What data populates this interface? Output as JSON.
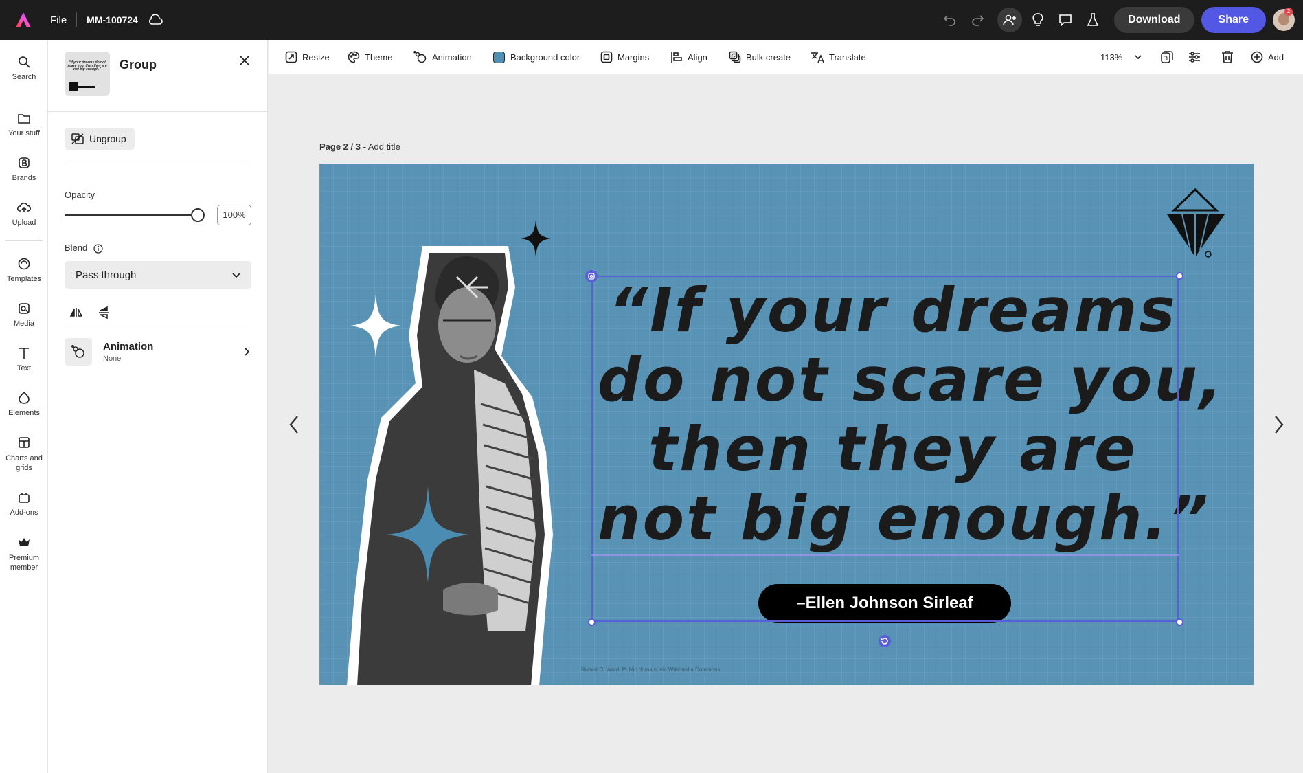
{
  "topbar": {
    "file_label": "File",
    "doc_name": "MM-100724",
    "download_label": "Download",
    "share_label": "Share",
    "notification_count": "2"
  },
  "rail": [
    {
      "label": "Search",
      "icon": "search-icon"
    },
    {
      "label": "Your stuff",
      "icon": "folder-icon"
    },
    {
      "label": "Brands",
      "icon": "brand-icon"
    },
    {
      "label": "Upload",
      "icon": "upload-icon"
    },
    {
      "label": "Templates",
      "icon": "templates-icon"
    },
    {
      "label": "Media",
      "icon": "media-icon"
    },
    {
      "label": "Text",
      "icon": "text-icon"
    },
    {
      "label": "Elements",
      "icon": "elements-icon"
    },
    {
      "label": "Charts and grids",
      "icon": "grid-icon"
    },
    {
      "label": "Add-ons",
      "icon": "addons-icon"
    },
    {
      "label": "Premium member",
      "icon": "crown-icon"
    }
  ],
  "panel": {
    "title": "Group",
    "ungroup_label": "Ungroup",
    "opacity_label": "Opacity",
    "opacity_value": "100%",
    "opacity_fraction": 1.0,
    "blend_label": "Blend",
    "blend_value": "Pass through",
    "animation_label": "Animation",
    "animation_value": "None",
    "thumb_text": "“If your dreams do not scare you, then they are not big enough.”"
  },
  "toolbar": {
    "resize": "Resize",
    "theme": "Theme",
    "animation": "Animation",
    "background_color": "Background color",
    "margins": "Margins",
    "align": "Align",
    "bulk_create": "Bulk create",
    "translate": "Translate",
    "zoom": "113%",
    "add": "Add"
  },
  "colors": {
    "canvas_bg": "#5892b4",
    "accent": "#5258e4"
  },
  "page": {
    "page_prefix": "Page 2 / 3 -",
    "add_title": "Add title"
  },
  "design": {
    "quote_lines": [
      "“If your dreams",
      "do not scare you,",
      "then they are",
      "not big enough.”"
    ],
    "author": "–Ellen Johnson Sirleaf",
    "credit": "Robert D. Ward, Public domain, via Wikimedia Commons"
  }
}
